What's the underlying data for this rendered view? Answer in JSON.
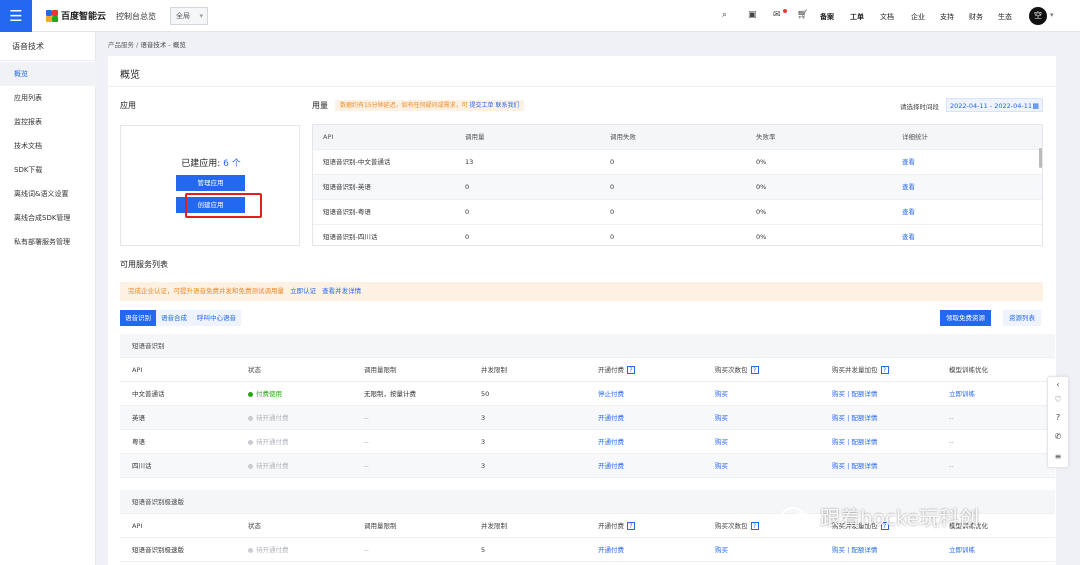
{
  "header": {
    "logo": "百度智能云",
    "console": "控制台总览",
    "region": "全局",
    "nav": [
      "备案",
      "工单",
      "文档",
      "企业",
      "支持",
      "财务",
      "生态"
    ],
    "avatar": "空"
  },
  "sidebar": {
    "title": "语音技术",
    "items": [
      {
        "label": "概览",
        "active": true
      },
      {
        "label": "应用列表"
      },
      {
        "label": "监控报表"
      },
      {
        "label": "技术文档"
      },
      {
        "label": "SDK下载"
      },
      {
        "label": "离线词&语义设置"
      },
      {
        "label": "离线合成SDK管理"
      },
      {
        "label": "私有部署服务管理"
      }
    ]
  },
  "breadcrumb": {
    "parent": "产品服务",
    "sep": "/",
    "current": "语音技术 - 概览"
  },
  "main": {
    "title": "概览",
    "apps_label": "应用",
    "apps_created_label": "已建应用:",
    "apps_created_count": "6 个",
    "manage_btn": "管理应用",
    "create_btn": "创建应用",
    "usage_label": "用量",
    "usage_note": "数据约有15分钟延迟，如有任何疑问或需求，可 ",
    "usage_note_link": "提交工单 联系我们",
    "range_label": "请选择时间段",
    "range_value": "2022-04-11 - 2022-04-11"
  },
  "usage_table": {
    "headers": [
      "API",
      "调用量",
      "调用失败",
      "失败率",
      "详细统计"
    ],
    "rows": [
      [
        "短语音识别-中文普通话",
        "13",
        "0",
        "0%",
        "查看"
      ],
      [
        "短语音识别-英语",
        "0",
        "0",
        "0%",
        "查看"
      ],
      [
        "短语音识别-粤语",
        "0",
        "0",
        "0%",
        "查看"
      ],
      [
        "短语音识别-四川话",
        "0",
        "0",
        "0%",
        "查看"
      ]
    ]
  },
  "services": {
    "title": "可用服务列表",
    "notice": "完成企业认证，可提升语音免费并发和免费测试调用量",
    "notice_link1": "立即认证",
    "notice_link2": "查看并发详情",
    "tabs": [
      "语音识别",
      "语音合成",
      "呼叫中心语音"
    ],
    "btn_free": "领取免费资源",
    "btn_list": "资源列表",
    "group1": "短语音识别",
    "group2": "短语音识别极速版",
    "headers": [
      "API",
      "状态",
      "调用量限制",
      "并发限制",
      "开通付费",
      "购买次数包",
      "购买并发量加包",
      "模型训练优化"
    ],
    "headers_alt": [
      "API",
      "状态",
      "调用量限制",
      "并发限制",
      "开通付费",
      "购买次数包",
      "购买并发量加包",
      "模型训练优化"
    ],
    "rows": [
      [
        "中文普通话",
        "付费使用",
        "无限制，按量计费",
        "50",
        "停止付费",
        "购买",
        "购买 | 配额详情",
        "立即训练"
      ],
      [
        "英语",
        "待开通付费",
        "--",
        "3",
        "开通付费",
        "购买",
        "购买 | 配额详情",
        "--"
      ],
      [
        "粤语",
        "待开通付费",
        "--",
        "3",
        "开通付费",
        "购买",
        "购买 | 配额详情",
        "--"
      ],
      [
        "四川话",
        "待开通付费",
        "--",
        "3",
        "开通付费",
        "购买",
        "购买 | 配额详情",
        "--"
      ]
    ],
    "rows2": [
      [
        "短语音识别极速版",
        "待开通付费",
        "--",
        "5",
        "开通付费",
        "购买",
        "购买 | 配额详情",
        "立即训练"
      ]
    ],
    "help": "?"
  },
  "watermark": "跟着hocke玩科创",
  "colors": {
    "primary": "#2468f2",
    "warning_bg": "#fdf1e3",
    "warning_text": "#f08a24",
    "highlight": "#e02020"
  }
}
